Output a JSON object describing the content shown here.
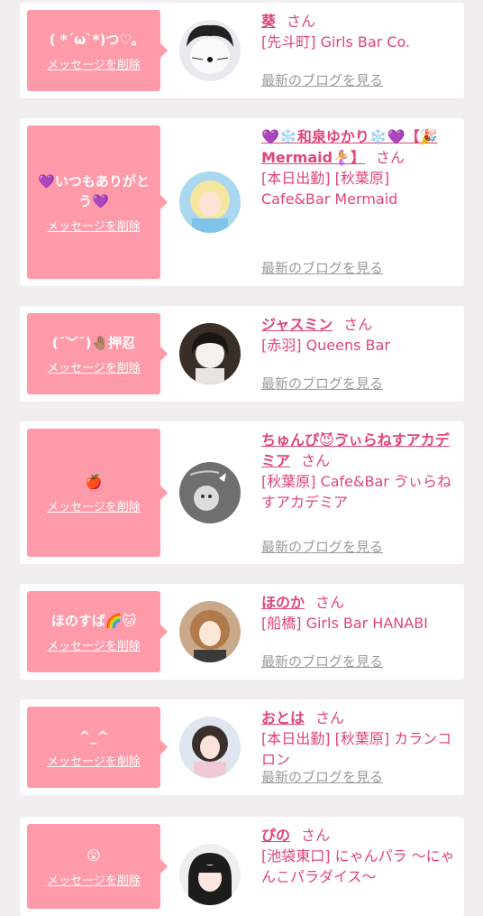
{
  "common": {
    "delete_label": "メッセージを削除",
    "san": "さん",
    "blog_label": "最新のブログを見る"
  },
  "colors": {
    "accent": "#e0457b",
    "bubble": "#ff9aa9",
    "muted": "#9b9b9b",
    "background": "#f1eef0"
  },
  "items": [
    {
      "message": "( *´ω`*)つ♡｡",
      "name": "葵",
      "shop": "[先斗町] Girls Bar Co."
    },
    {
      "message": "💜いつもありがとう💜",
      "name": "💜❄️和泉ゆかり❄️💜【🎉Mermaid🧜‍♀️】",
      "shop": "[本日出勤] [秋葉原] Cafe&Bar Mermaid"
    },
    {
      "message": "(¯﹀¯)🤚🏽押忍",
      "name": "ジャスミン",
      "shop": "[赤羽] Queens Bar"
    },
    {
      "message": "🍎",
      "name": "ちゅんぴ😈ゔぃらねすアカデミア",
      "shop": "[秋葉原] Cafe&Bar ゔぃらねすアカデミア"
    },
    {
      "message": "ほのすば🌈🐱",
      "name": "ほのか",
      "shop": "[船橋] Girls Bar HANABI"
    },
    {
      "message": "^_^",
      "name": "おとは",
      "shop": "[本日出勤] [秋葉原] カランコロン"
    },
    {
      "message": "😮",
      "name": "ぴの",
      "shop": "[池袋東口] にゃんパラ 〜にゃんこパラダイス〜"
    }
  ]
}
